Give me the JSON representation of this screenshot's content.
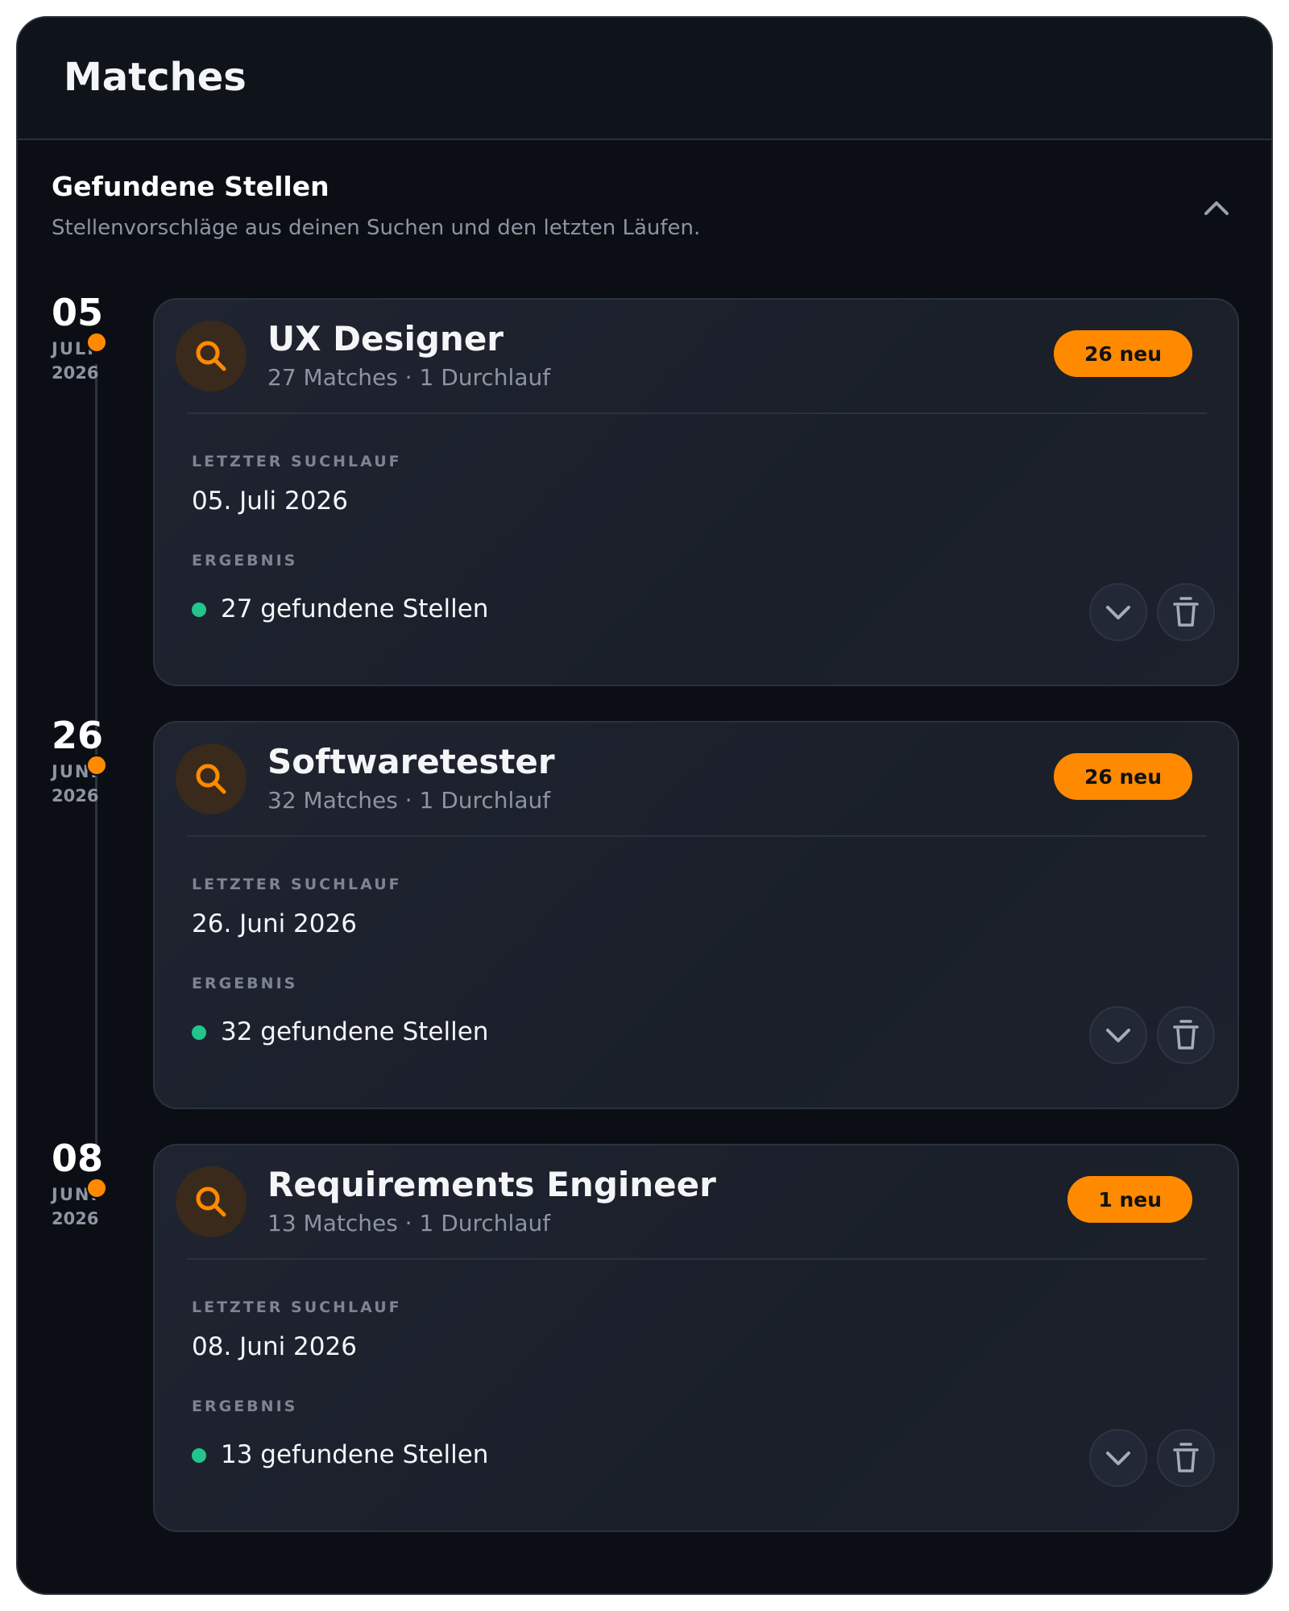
{
  "header": {
    "title": "Matches"
  },
  "section": {
    "title": "Gefundene Stellen",
    "subtitle": "Stellenvorschläge aus deinen Suchen und den letzten Läufen."
  },
  "labels": {
    "last_run": "LETZTER SUCHLAUF",
    "result": "ERGEBNIS"
  },
  "colors": {
    "accent": "#ff8a00",
    "success": "#22c58b",
    "background": "#0b0e14",
    "card": "#1f2430"
  },
  "entries": [
    {
      "date": {
        "day": "05",
        "month": "JULI",
        "year": "2026"
      },
      "title": "UX Designer",
      "meta": "27 Matches · 1 Durchlauf",
      "badge": "26 neu",
      "last_run": "05. Juli 2026",
      "result": "27 gefundene Stellen"
    },
    {
      "date": {
        "day": "26",
        "month": "JUNI",
        "year": "2026"
      },
      "title": "Softwaretester",
      "meta": "32 Matches · 1 Durchlauf",
      "badge": "26 neu",
      "last_run": "26. Juni 2026",
      "result": "32 gefundene Stellen"
    },
    {
      "date": {
        "day": "08",
        "month": "JUNI",
        "year": "2026"
      },
      "title": "Requirements Engineer",
      "meta": "13 Matches · 1 Durchlauf",
      "badge": "1 neu",
      "last_run": "08. Juni 2026",
      "result": "13 gefundene Stellen"
    }
  ]
}
